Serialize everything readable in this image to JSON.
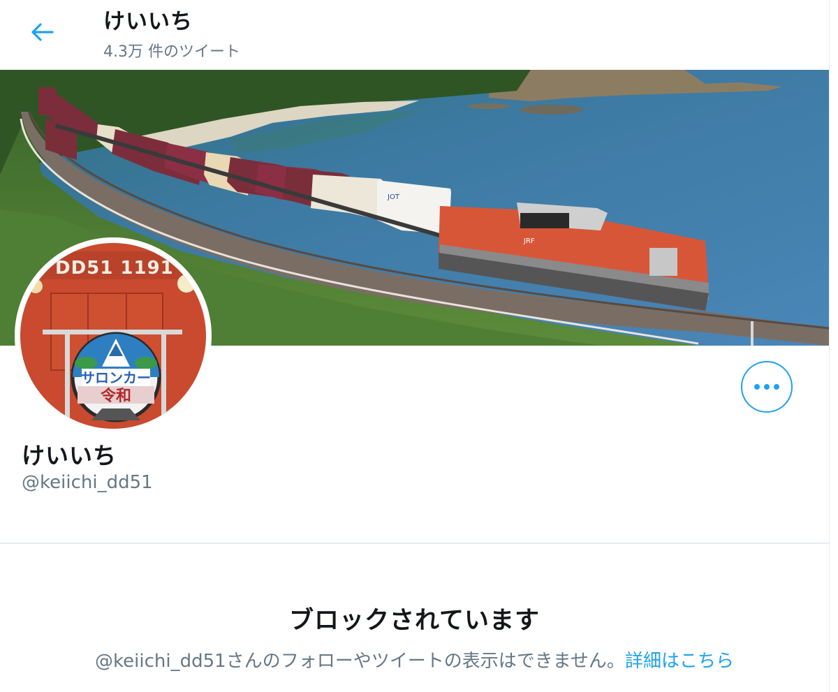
{
  "header": {
    "title": "けいいち",
    "tweet_count": "4.3万 件のツイート"
  },
  "profile": {
    "name": "けいいち",
    "handle": "@keiichi_dd51"
  },
  "avatar": {
    "locomotive_number": "DD51 1191",
    "headmark_line1": "サロンカー",
    "headmark_line2": "令和"
  },
  "banner": {
    "container_mark": "JOT",
    "loco_mark": "JRF"
  },
  "blocked": {
    "title": "ブロックされています",
    "message": "@keiichi_dd51さんのフォローやツイートの表示はできません。",
    "link": "詳細はこちら"
  },
  "icons": {
    "back": "arrow-left-icon",
    "more": "more-horizontal-icon"
  },
  "colors": {
    "accent": "#1da1f2",
    "secondary_text": "#657786",
    "divider": "#e6ecf0"
  }
}
